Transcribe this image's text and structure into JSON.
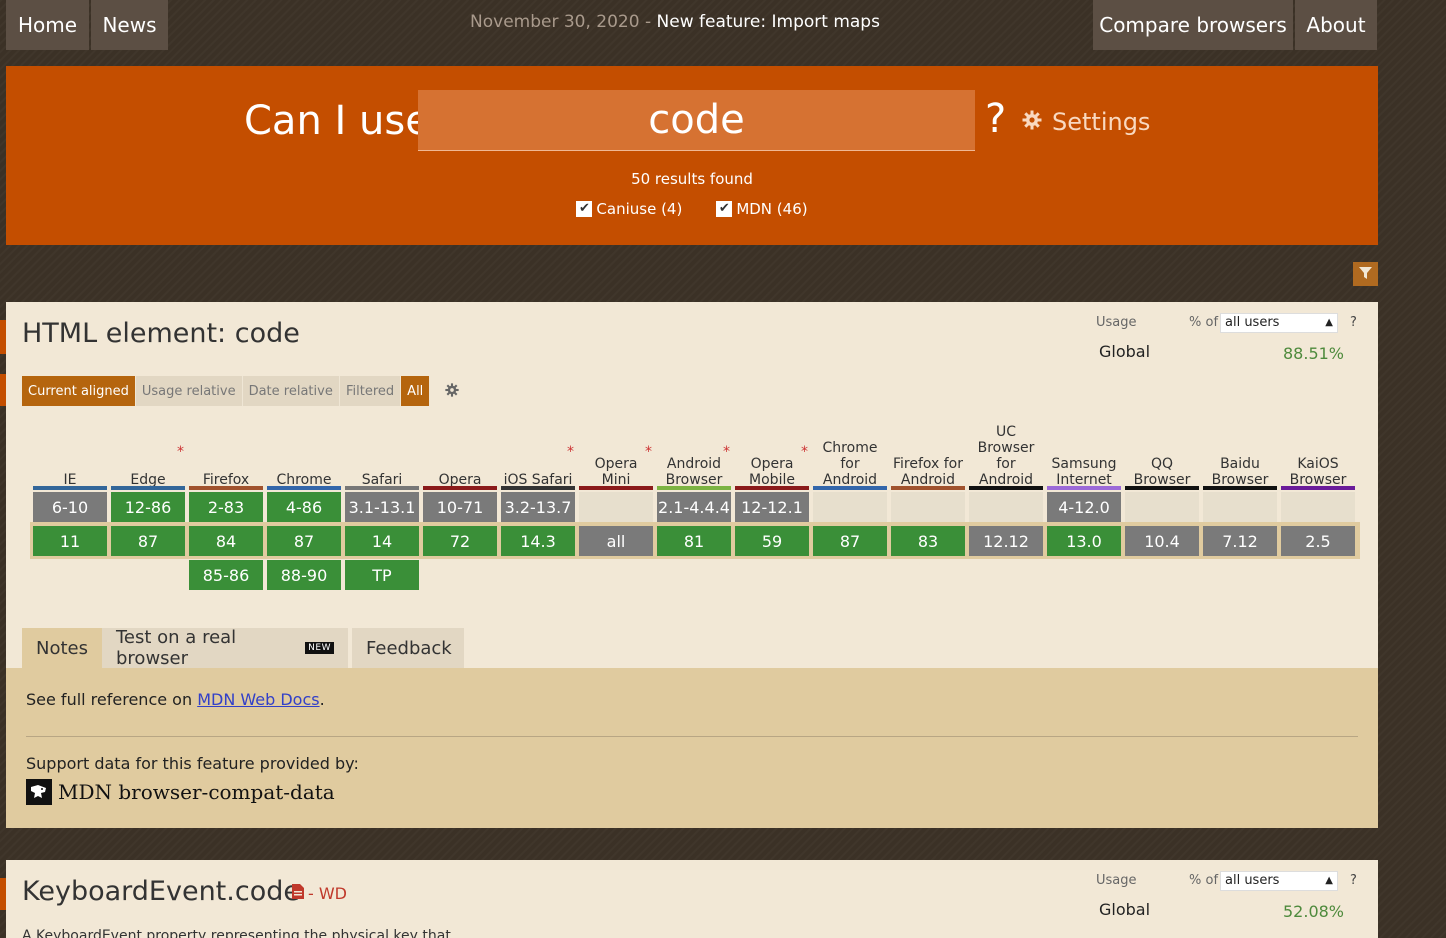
{
  "nav": {
    "home": "Home",
    "news": "News",
    "compare": "Compare browsers",
    "about": "About"
  },
  "announcement": {
    "date": "November 30, 2020",
    "separator": " - ",
    "link": "New feature: Import maps"
  },
  "hero": {
    "label": "Can I use",
    "search_value": "code",
    "question_mark": "?",
    "settings_label": "Settings",
    "results": "50 results found",
    "filters": [
      {
        "label": "Caniuse (4)",
        "checked": true
      },
      {
        "label": "MDN (46)",
        "checked": true
      }
    ]
  },
  "colors": {
    "brand": "#c44e00",
    "supported": "#3a8f38",
    "unsupported": "#7a7a7a",
    "card": "#f2e8d6",
    "notes": "#e0cb9f"
  },
  "feature1": {
    "title": "HTML element: code",
    "usage": {
      "label": "Usage",
      "pct_of": "% of",
      "select_value": "all users",
      "help": "?",
      "region": "Global",
      "percent": "88.51%"
    },
    "modes": [
      "Current aligned",
      "Usage relative",
      "Date relative"
    ],
    "filter_modes": [
      "Filtered",
      "All"
    ],
    "browsers": [
      {
        "name": "IE",
        "star": false,
        "stripe": "#336699",
        "past": "6-10",
        "past_s": "n",
        "current": "11",
        "current_s": "y",
        "future": "",
        "future_s": ""
      },
      {
        "name": "Edge",
        "star": true,
        "stripe": "#336699",
        "past": "12-86",
        "past_s": "y",
        "current": "87",
        "current_s": "y",
        "future": "",
        "future_s": ""
      },
      {
        "name": "Firefox",
        "star": false,
        "stripe": "#a0522d",
        "past": "2-83",
        "past_s": "y",
        "current": "84",
        "current_s": "y",
        "future": "85-86",
        "future_s": "y"
      },
      {
        "name": "Chrome",
        "star": false,
        "stripe": "#3366aa",
        "past": "4-86",
        "past_s": "y",
        "current": "87",
        "current_s": "y",
        "future": "88-90",
        "future_s": "y"
      },
      {
        "name": "Safari",
        "star": false,
        "stripe": "#777777",
        "past": "3.1-13.1",
        "past_s": "n",
        "current": "14",
        "current_s": "y",
        "future": "TP",
        "future_s": "y"
      },
      {
        "name": "Opera",
        "star": false,
        "stripe": "#8b1a1a",
        "past": "10-71",
        "past_s": "n",
        "current": "72",
        "current_s": "y",
        "future": "",
        "future_s": ""
      },
      {
        "name": "iOS Safari",
        "star": true,
        "stripe": "#333333",
        "past": "3.2-13.7",
        "past_s": "n",
        "current": "14.3",
        "current_s": "y",
        "future": "",
        "future_s": ""
      },
      {
        "name": "Opera Mini",
        "star": true,
        "stripe": "#8b1a1a",
        "past": "",
        "past_s": "u",
        "current": "all",
        "current_s": "n",
        "future": "",
        "future_s": ""
      },
      {
        "name": "Android Browser",
        "star": true,
        "stripe": "#7cb342",
        "past": "2.1-4.4.4",
        "past_s": "n",
        "current": "81",
        "current_s": "y",
        "future": "",
        "future_s": ""
      },
      {
        "name": "Opera Mobile",
        "star": true,
        "stripe": "#8b1a1a",
        "past": "12-12.1",
        "past_s": "n",
        "current": "59",
        "current_s": "y",
        "future": "",
        "future_s": ""
      },
      {
        "name": "Chrome for Android",
        "star": false,
        "stripe": "#3366aa",
        "past": "",
        "past_s": "u",
        "current": "87",
        "current_s": "y",
        "future": "",
        "future_s": ""
      },
      {
        "name": "Firefox for Android",
        "star": false,
        "stripe": "#a0522d",
        "past": "",
        "past_s": "u",
        "current": "83",
        "current_s": "y",
        "future": "",
        "future_s": ""
      },
      {
        "name": "UC Browser for Android",
        "star": false,
        "stripe": "#111111",
        "past": "",
        "past_s": "u",
        "current": "12.12",
        "current_s": "n",
        "future": "",
        "future_s": ""
      },
      {
        "name": "Samsung Internet",
        "star": false,
        "stripe": "#9c6ad8",
        "past": "4-12.0",
        "past_s": "n",
        "current": "13.0",
        "current_s": "y",
        "future": "",
        "future_s": ""
      },
      {
        "name": "QQ Browser",
        "star": false,
        "stripe": "#111111",
        "past": "",
        "past_s": "u",
        "current": "10.4",
        "current_s": "n",
        "future": "",
        "future_s": ""
      },
      {
        "name": "Baidu Browser",
        "star": false,
        "stripe": "#111111",
        "past": "",
        "past_s": "u",
        "current": "7.12",
        "current_s": "n",
        "future": "",
        "future_s": ""
      },
      {
        "name": "KaiOS Browser",
        "star": false,
        "stripe": "#6a1b9a",
        "past": "",
        "past_s": "u",
        "current": "2.5",
        "current_s": "n",
        "future": "",
        "future_s": ""
      }
    ],
    "tabs": {
      "notes": "Notes",
      "test": "Test on a real browser",
      "new_badge": "NEW",
      "feedback": "Feedback"
    },
    "notes": {
      "prefix": "See full reference on ",
      "link": "MDN Web Docs",
      "suffix": ".",
      "support": "Support data for this feature provided by:",
      "mdn_logo_text": "MDN browser-compat-data"
    }
  },
  "feature2": {
    "title": "KeyboardEvent.code",
    "status": "- WD",
    "usage": {
      "label": "Usage",
      "pct_of": "% of",
      "select_value": "all users",
      "help": "?",
      "region": "Global",
      "percent": "52.08%"
    },
    "description": "A KeyboardEvent property representing the physical key that"
  }
}
